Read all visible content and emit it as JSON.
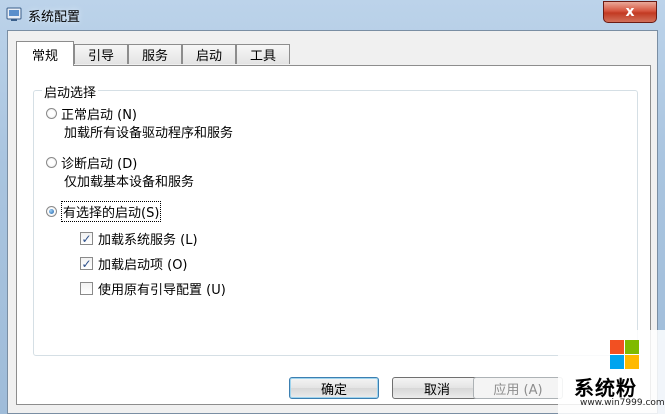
{
  "window": {
    "title": "系统配置",
    "close_label": "x"
  },
  "tabs": [
    {
      "label": "常规",
      "active": true
    },
    {
      "label": "引导"
    },
    {
      "label": "服务"
    },
    {
      "label": "启动"
    },
    {
      "label": "工具"
    }
  ],
  "startup_selection": {
    "legend": "启动选择",
    "normal": {
      "label": "正常启动 (N)",
      "desc": "加载所有设备驱动程序和服务",
      "selected": false
    },
    "diagnostic": {
      "label": "诊断启动 (D)",
      "desc": "仅加载基本设备和服务",
      "selected": false
    },
    "selective": {
      "label": "有选择的启动(S)",
      "selected": true
    },
    "options": [
      {
        "label": "加载系统服务 (L)",
        "checked": true
      },
      {
        "label": "加载启动项 (O)",
        "checked": true
      },
      {
        "label": "使用原有引导配置 (U)",
        "checked": false
      }
    ]
  },
  "buttons": {
    "ok": "确定",
    "cancel": "取消",
    "apply": "应用 (A)"
  },
  "watermark": {
    "text": "系统粉",
    "url": "www.win7999.com"
  },
  "colors": {
    "logo_red": "#f25022",
    "logo_green": "#7fba00",
    "logo_blue": "#00a4ef",
    "logo_yellow": "#ffb900"
  }
}
